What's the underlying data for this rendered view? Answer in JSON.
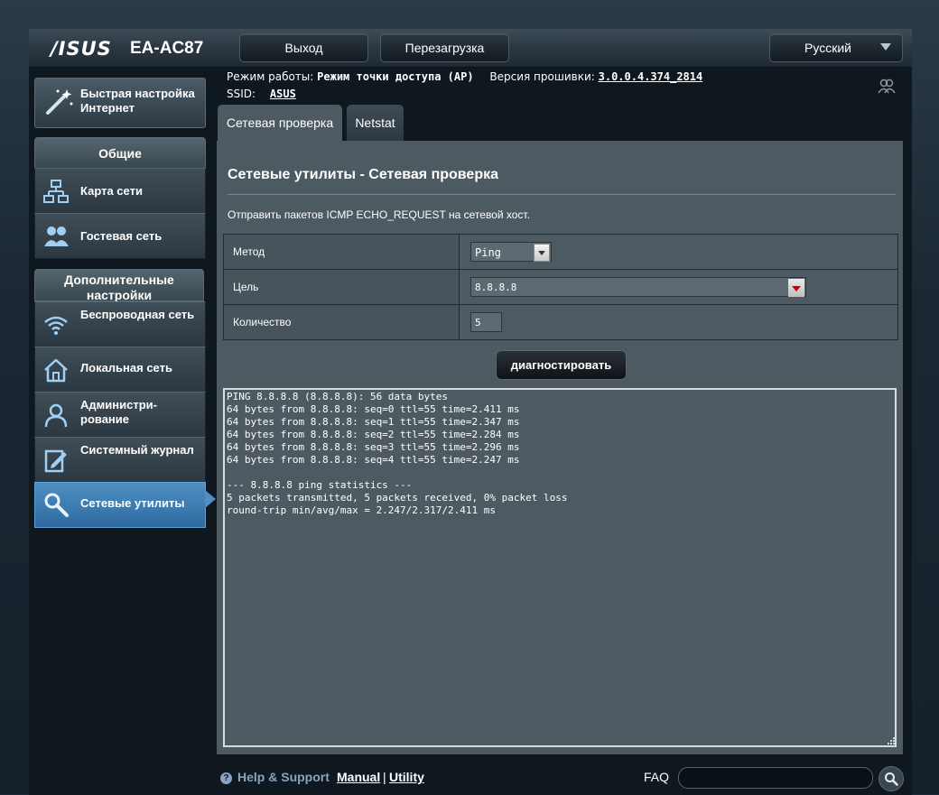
{
  "header": {
    "brand": "/ISUS",
    "model": "EA-AC87",
    "logout_label": "Выход",
    "reboot_label": "Перезагрузка",
    "language": "Русский"
  },
  "status": {
    "mode_label": "Режим работы:",
    "mode_value": "Режим точки доступа (AP)",
    "firmware_label": "Версия прошивки:",
    "firmware_value": "3.0.0.4.374_2814",
    "ssid_label": "SSID:",
    "ssid_value": "ASUS"
  },
  "sidebar": {
    "quick_setup": "Быстрая настройка Интернет",
    "general_title": "Общие",
    "general_items": [
      {
        "label": "Карта сети",
        "icon": "network-map-icon"
      },
      {
        "label": "Гостевая сеть",
        "icon": "guest-network-icon"
      }
    ],
    "advanced_title": "Дополнительные настройки",
    "advanced_items": [
      {
        "label": "Беспроводная сеть",
        "icon": "wireless-icon"
      },
      {
        "label": "Локальная сеть",
        "icon": "lan-home-icon"
      },
      {
        "label": "Администри-рование",
        "icon": "admin-user-icon"
      },
      {
        "label": "Системный журнал",
        "icon": "system-log-icon"
      },
      {
        "label": "Сетевые утилиты",
        "icon": "network-tools-icon",
        "active": true
      }
    ]
  },
  "tabs": [
    {
      "label": "Сетевая проверка",
      "active": true
    },
    {
      "label": "Netstat",
      "active": false
    }
  ],
  "content": {
    "title": "Сетевые утилиты - Сетевая проверка",
    "description": "Отправить пакетов ICMP ECHO_REQUEST на сетевой хост.",
    "fields": {
      "method_label": "Метод",
      "method_value": "Ping",
      "target_label": "Цель",
      "target_value": "8.8.8.8",
      "count_label": "Количество",
      "count_value": "5"
    },
    "diagnose_label": "диагностировать",
    "output": "PING 8.8.8.8 (8.8.8.8): 56 data bytes\n64 bytes from 8.8.8.8: seq=0 ttl=55 time=2.411 ms\n64 bytes from 8.8.8.8: seq=1 ttl=55 time=2.347 ms\n64 bytes from 8.8.8.8: seq=2 ttl=55 time=2.284 ms\n64 bytes from 8.8.8.8: seq=3 ttl=55 time=2.296 ms\n64 bytes from 8.8.8.8: seq=4 ttl=55 time=2.247 ms\n\n--- 8.8.8.8 ping statistics ---\n5 packets transmitted, 5 packets received, 0% packet loss\nround-trip min/avg/max = 2.247/2.317/2.411 ms"
  },
  "footer": {
    "help": "Help & Support",
    "manual": "Manual",
    "separator": "|",
    "utility": "Utility",
    "faq": "FAQ"
  },
  "colors": {
    "active_menu": "#4f8fc4",
    "panel": "#4d5a62",
    "link": "#87a3c2"
  }
}
